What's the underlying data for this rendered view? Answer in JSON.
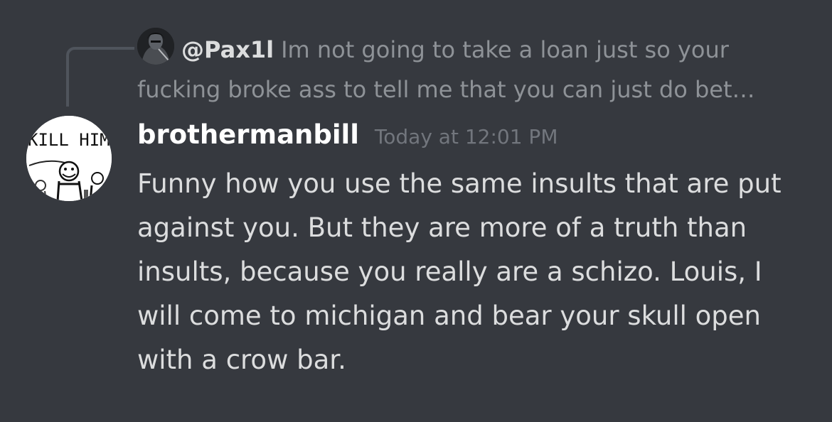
{
  "reply": {
    "author": "@Pax1l",
    "preview": "Im not going to take a loan just so your fucking broke ass to tell me that you can just do bet…",
    "avatar_icon": "dark-figure-avatar-icon"
  },
  "message": {
    "author": "brothermanbill",
    "timestamp": "Today at 12:01 PM",
    "content": "Funny how you use the same insults that are put against you. But they are more of a truth than insults, because you really are a schizo. Louis, I will come to michigan and bear your skull open with a crow bar.",
    "avatar_text": "KILL HIM",
    "avatar_icon": "kill-him-sketch-avatar-icon"
  },
  "colors": {
    "background": "#36393f",
    "username": "#ffffff",
    "message_text": "#dcddde",
    "muted_text": "#8e9297",
    "timestamp": "#72767d",
    "reply_spine": "#4f545c"
  }
}
